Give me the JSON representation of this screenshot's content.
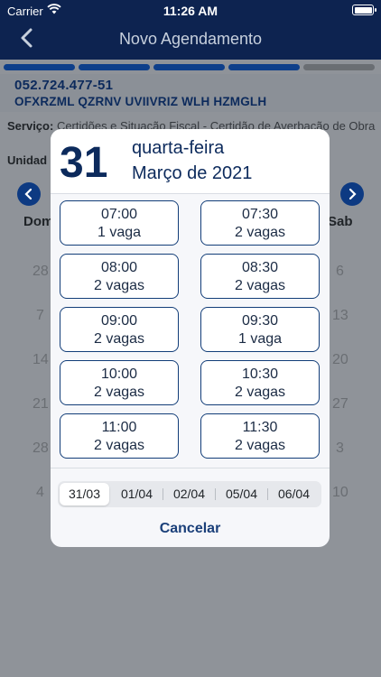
{
  "status": {
    "carrier": "Carrier",
    "time": "11:26 AM"
  },
  "nav": {
    "title": "Novo Agendamento"
  },
  "user": {
    "cpf": "052.724.477-51",
    "name": "OFXRZML QZRNV UVIIVRIZ WLH HZMGLH"
  },
  "service": {
    "label": "Serviço:",
    "text": "Certidões e Situação Fiscal - Certidão de Averbação de Obra"
  },
  "unidade": {
    "label": "Unidad"
  },
  "calendar": {
    "first_day": "Dom",
    "last_day": "Sab",
    "left_numbers": [
      "28",
      "7",
      "14",
      "21",
      "28",
      "4"
    ],
    "right_numbers": [
      "6",
      "13",
      "20",
      "27",
      "3",
      "10"
    ]
  },
  "modal": {
    "day": "31",
    "weekday": "quarta-feira",
    "month_year": "Março de 2021",
    "slots": [
      {
        "time": "07:00",
        "vagas": "1 vaga"
      },
      {
        "time": "07:30",
        "vagas": "2 vagas"
      },
      {
        "time": "08:00",
        "vagas": "2 vagas"
      },
      {
        "time": "08:30",
        "vagas": "2 vagas"
      },
      {
        "time": "09:00",
        "vagas": "2 vagas"
      },
      {
        "time": "09:30",
        "vagas": "1 vaga"
      },
      {
        "time": "10:00",
        "vagas": "2 vagas"
      },
      {
        "time": "10:30",
        "vagas": "2 vagas"
      },
      {
        "time": "11:00",
        "vagas": "2 vagas"
      },
      {
        "time": "11:30",
        "vagas": "2 vagas"
      }
    ],
    "dates": [
      "31/03",
      "01/04",
      "02/04",
      "05/04",
      "06/04"
    ],
    "selected_date": "31/03",
    "cancel": "Cancelar"
  },
  "colors": {
    "navy": "#0d2350",
    "accent": "#0d3a82",
    "slot_border": "#123d78"
  }
}
